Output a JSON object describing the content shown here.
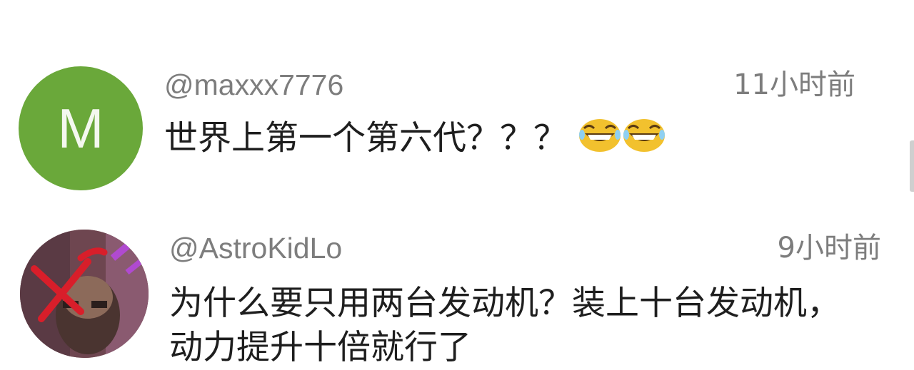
{
  "comments": [
    {
      "avatar_letter": "M",
      "avatar_color": "#6aa83a",
      "username": "@maxxx7776",
      "time": "11小时前",
      "text": "世界上第一个第六代？？？",
      "emoji_count": 2,
      "emoji_icon": "laughing-emoji-icon"
    },
    {
      "avatar_color": "#7a4a4e",
      "username": "@AstroKidLo",
      "time": "9小时前",
      "text": "为什么要只用两台发动机？装上十台发动机，动力提升十倍就行了 "
    }
  ],
  "scrollbar_color": "#cfcfcf"
}
